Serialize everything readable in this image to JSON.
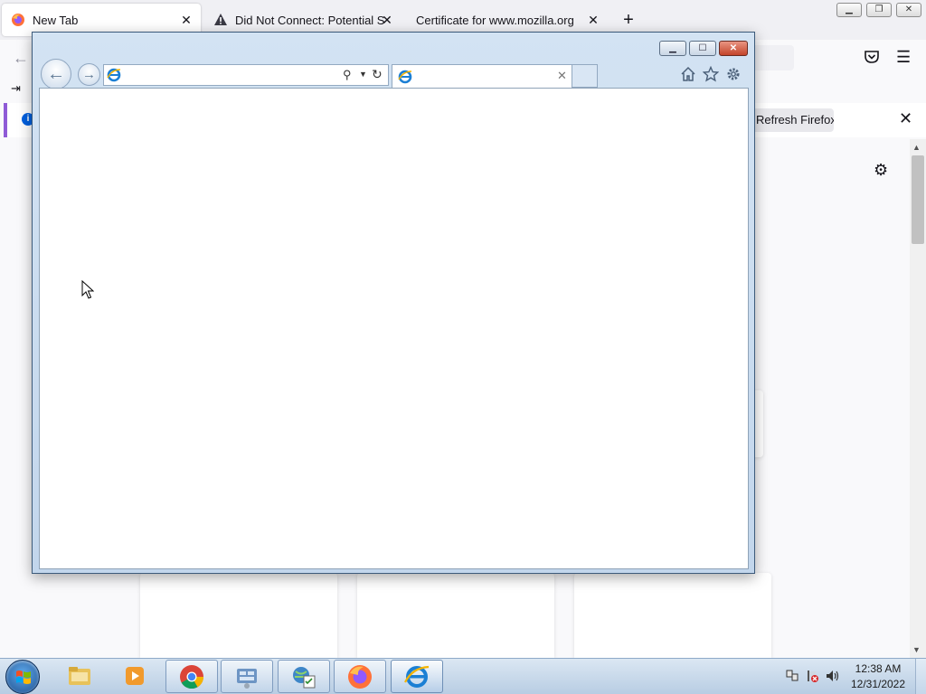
{
  "firefox": {
    "tabs": [
      {
        "label": "New Tab",
        "active": true
      },
      {
        "label": "Did Not Connect: Potential Security Issue",
        "active": false
      },
      {
        "label": "Certificate for www.mozilla.org",
        "active": false
      }
    ],
    "new_tab_label": "+",
    "notice": {
      "refresh_button": "Refresh Firefox..."
    }
  },
  "ie": {
    "address_value": "",
    "tab_label": ""
  },
  "taskbar": {
    "clock_time": "12:38 AM",
    "clock_date": "12/31/2022"
  },
  "icons": {
    "firefox": "firefox-icon",
    "warning": "warning-triangle-icon",
    "ie": "internet-explorer-icon",
    "chrome": "chrome-icon",
    "explorer": "folder-icon",
    "media": "media-player-icon",
    "control_panel": "control-panel-icon",
    "network": "network-task-icon"
  },
  "colors": {
    "ff_notice_accent": "#8f5bd6",
    "ie_frame": "#c2d6ec",
    "taskbar": "#b8cde3",
    "close_button": "#c3442a"
  }
}
